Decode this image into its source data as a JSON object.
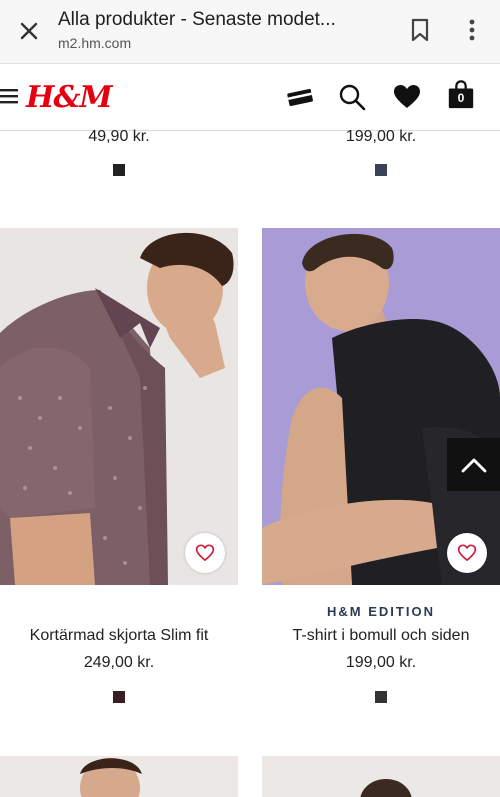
{
  "browser": {
    "title": "Alla produkter - Senaste modet...",
    "url": "m2.hm.com",
    "icons": [
      "close-icon",
      "bookmark-icon",
      "more-vert-icon"
    ]
  },
  "header": {
    "logo": "H&M",
    "bag_count": "0",
    "icons": [
      "menu-icon",
      "membership-card-icon",
      "search-icon",
      "heart-icon",
      "shopping-bag-icon"
    ],
    "brand_color": "#e50010"
  },
  "previous_row": [
    {
      "price": "49,90 kr.",
      "swatch_color": "#222222"
    },
    {
      "price": "199,00 kr.",
      "swatch_color": "#3b4257"
    }
  ],
  "products": [
    {
      "brand": "",
      "name": "Kortärmad skjorta Slim fit",
      "price": "249,00 kr.",
      "swatch_color": "#3a1f22",
      "image": "man-in-patterned-short-sleeve-shirt"
    },
    {
      "brand": "H&M EDITION",
      "name": "T-shirt i bomull och siden",
      "price": "199,00 kr.",
      "swatch_color": "#333333",
      "image": "man-in-black-tshirt-purple-background"
    }
  ]
}
